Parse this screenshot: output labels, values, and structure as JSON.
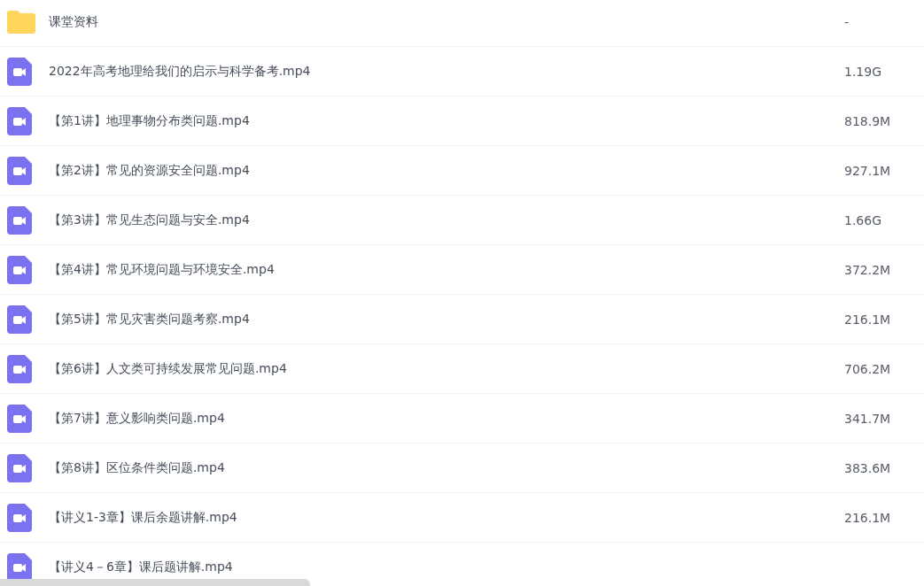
{
  "files": [
    {
      "kind": "folder",
      "name": "课堂资料",
      "size": "-"
    },
    {
      "kind": "video",
      "name": "2022年高考地理给我们的启示与科学备考.mp4",
      "size": "1.19G"
    },
    {
      "kind": "video",
      "name": "【第1讲】地理事物分布类问题.mp4",
      "size": "818.9M"
    },
    {
      "kind": "video",
      "name": "【第2讲】常见的资源安全问题.mp4",
      "size": "927.1M"
    },
    {
      "kind": "video",
      "name": "【第3讲】常见生态问题与安全.mp4",
      "size": "1.66G"
    },
    {
      "kind": "video",
      "name": "【第4讲】常见环境问题与环境安全.mp4",
      "size": "372.2M"
    },
    {
      "kind": "video",
      "name": "【第5讲】常见灾害类问题考察.mp4",
      "size": "216.1M"
    },
    {
      "kind": "video",
      "name": "【第6讲】人文类可持续发展常见问题.mp4",
      "size": "706.2M"
    },
    {
      "kind": "video",
      "name": "【第7讲】意义影响类问题.mp4",
      "size": "341.7M"
    },
    {
      "kind": "video",
      "name": "【第8讲】区位条件类问题.mp4",
      "size": "383.6M"
    },
    {
      "kind": "video",
      "name": "【讲义1-3章】课后余题讲解.mp4",
      "size": "216.1M"
    },
    {
      "kind": "video",
      "name": "【讲义4－6章】课后题讲解.mp4"
    }
  ]
}
